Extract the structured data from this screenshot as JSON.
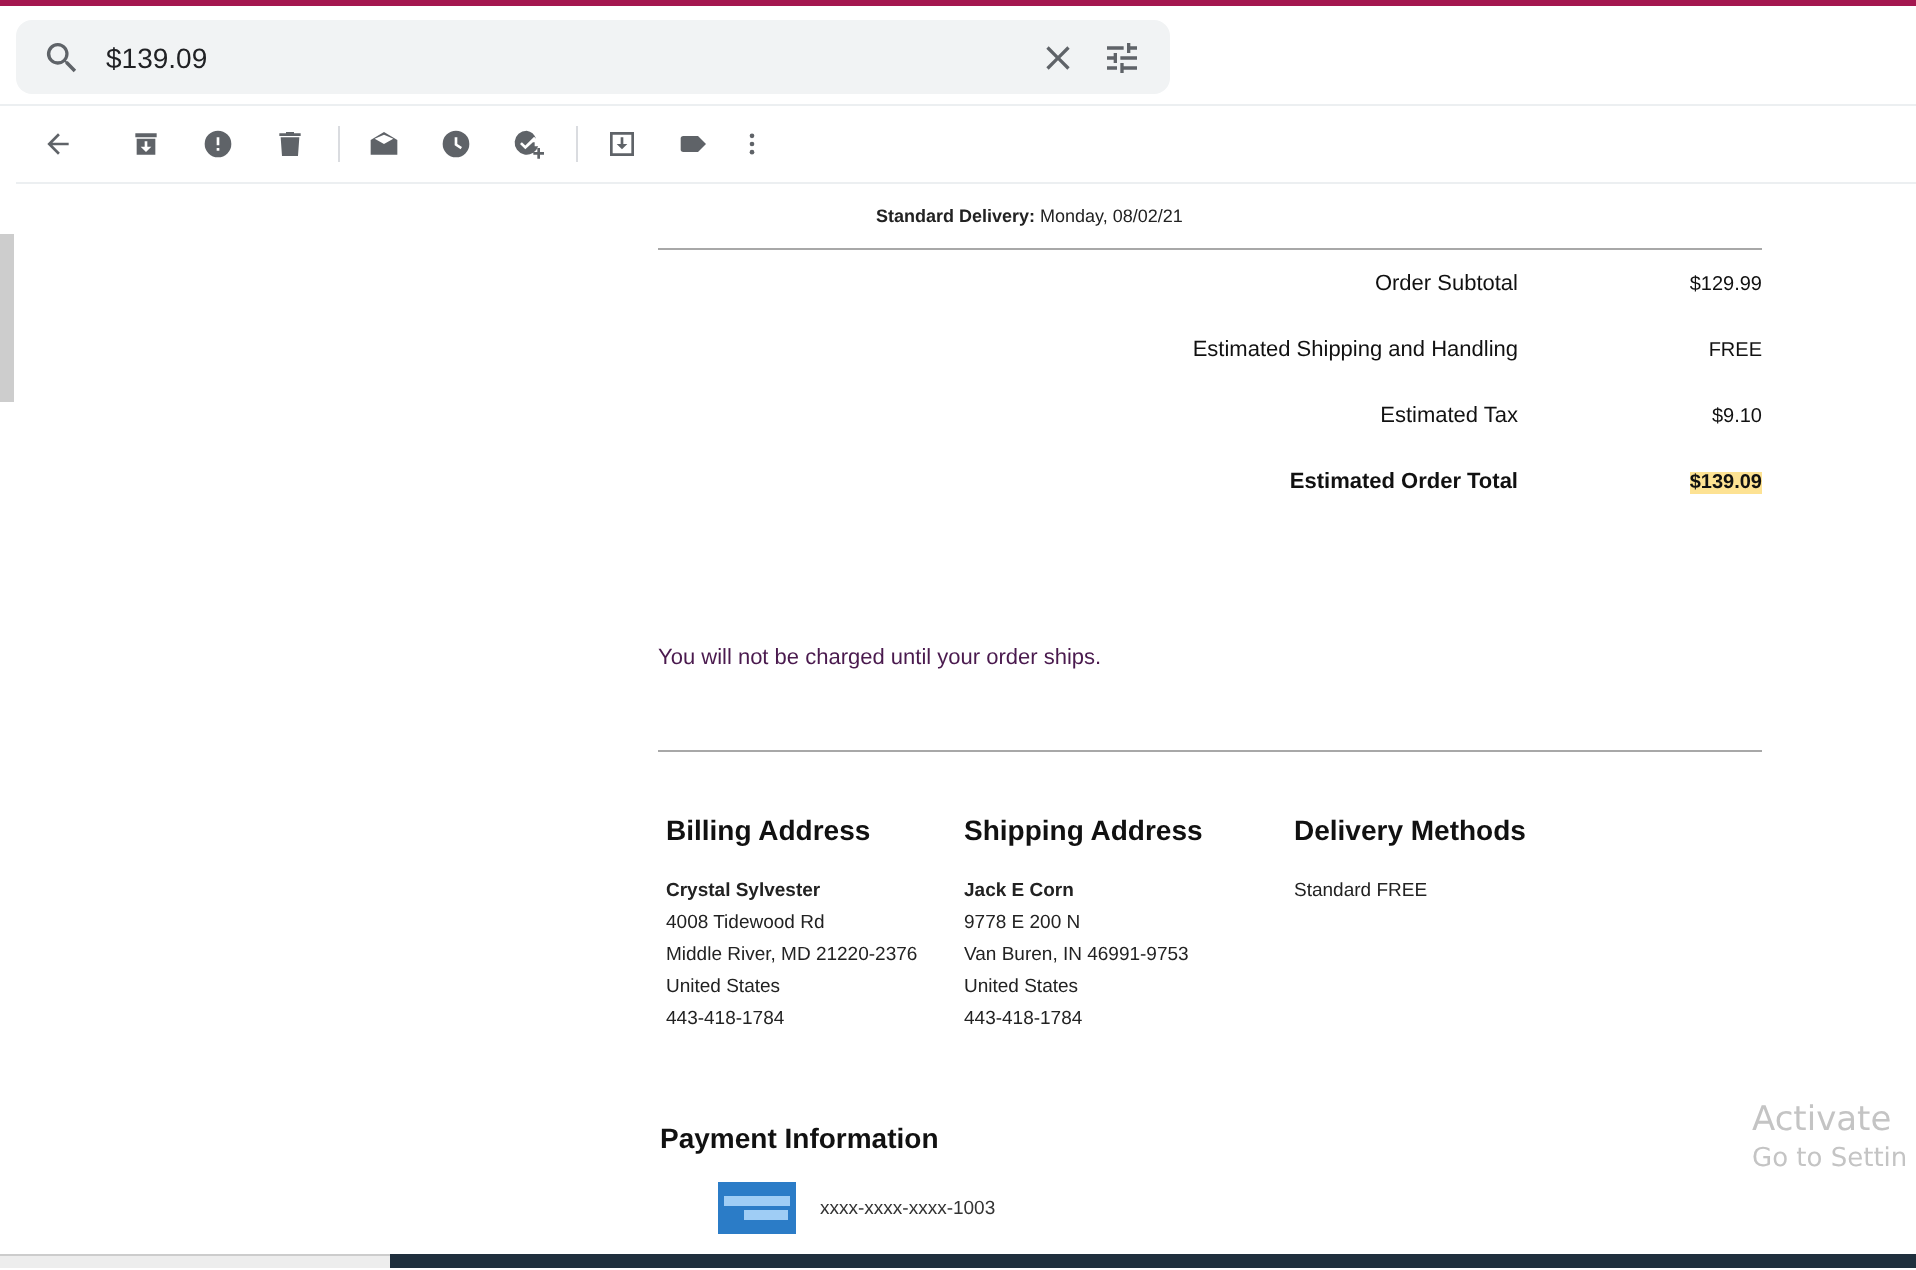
{
  "search": {
    "value": "$139.09"
  },
  "email": {
    "delivery_line": "**Standard Delivery:** Monday, 08/02/21",
    "totals": [
      {
        "label": "Order Subtotal",
        "value": "$129.99",
        "bold": false,
        "highlighted": false
      },
      {
        "label": "Estimated Shipping and Handling",
        "value": "FREE",
        "bold": false,
        "highlighted": false
      },
      {
        "label": "Estimated Tax",
        "value": "$9.10",
        "bold": false,
        "highlighted": false
      },
      {
        "label": "Estimated Order Total",
        "value": "$139.09",
        "bold": true,
        "highlighted": true
      }
    ],
    "notice": "You will not be charged until your order ships.",
    "columns": [
      {
        "heading": "Billing Address",
        "name": "Crystal Sylvester",
        "lines": [
          "4008 Tidewood Rd",
          "Middle River, MD 21220-2376",
          "United States",
          "443-418-1784"
        ]
      },
      {
        "heading": "Shipping Address",
        "name": "Jack E Corn",
        "lines": [
          "9778 E 200 N",
          "Van Buren, IN 46991-9753",
          "United States",
          "443-418-1784"
        ]
      },
      {
        "heading": "Delivery Methods",
        "lines": [
          "Standard FREE"
        ]
      }
    ],
    "payment": {
      "heading": "Payment Information",
      "card_number": "xxxx-xxxx-xxxx-1003"
    }
  },
  "overlay": {
    "title": "Activate",
    "subtitle": "Go to Settin"
  }
}
